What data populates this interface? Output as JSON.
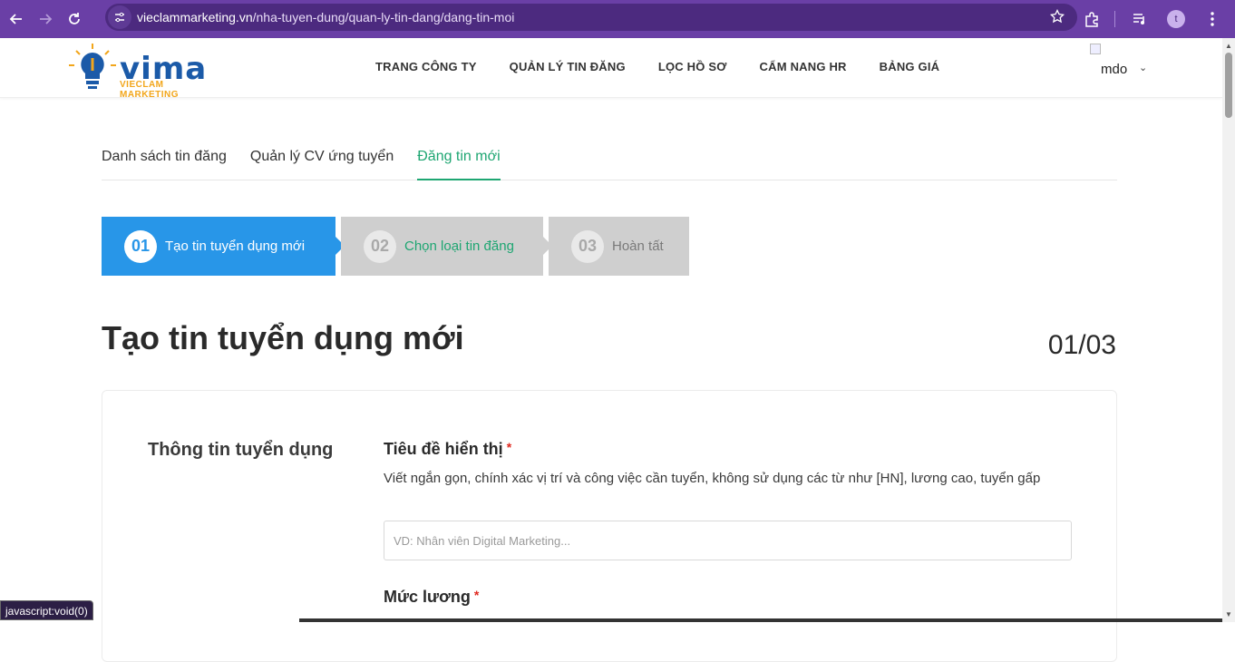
{
  "browser": {
    "url_host": "vieclammarketing.vn",
    "url_path": "/nha-tuyen-dung/quan-ly-tin-dang/dang-tin-moi",
    "profile_initial": "t",
    "status_text": "javascript:void(0)"
  },
  "site": {
    "logo_word": "vima",
    "logo_sub": "VIECLAM MARKETING",
    "nav": [
      "TRANG CÔNG TY",
      "QUẢN LÝ TIN ĐĂNG",
      "LỌC HỒ SƠ",
      "CẨM NANG HR",
      "BẢNG GIÁ"
    ],
    "user_name": "mdo"
  },
  "tabs": [
    "Danh sách tin đăng",
    "Quản lý CV ứng tuyển",
    "Đăng tin mới"
  ],
  "active_tab": 2,
  "steps": [
    {
      "num": "01",
      "label": "Tạo tin tuyển dụng mới"
    },
    {
      "num": "02",
      "label": "Chọn loại tin đăng"
    },
    {
      "num": "03",
      "label": "Hoàn tất"
    }
  ],
  "page": {
    "title": "Tạo tin tuyển dụng mới",
    "step_count": "01/03"
  },
  "form": {
    "section_title": "Thông tin tuyển dụng",
    "title_label": "Tiêu đề hiển thị",
    "required_mark": "*",
    "title_help": "Viết ngắn gọn, chính xác vị trí và công việc cần tuyển, không sử dụng các từ như [HN], lương cao, tuyển gấp",
    "title_placeholder": "VD: Nhân viên Digital Marketing...",
    "salary_label": "Mức lương"
  },
  "colors": {
    "browser_frame": "#6a3fa6",
    "step_active": "#2896e8",
    "accent_green": "#1ea672",
    "step_inactive": "#cfcfcf"
  }
}
